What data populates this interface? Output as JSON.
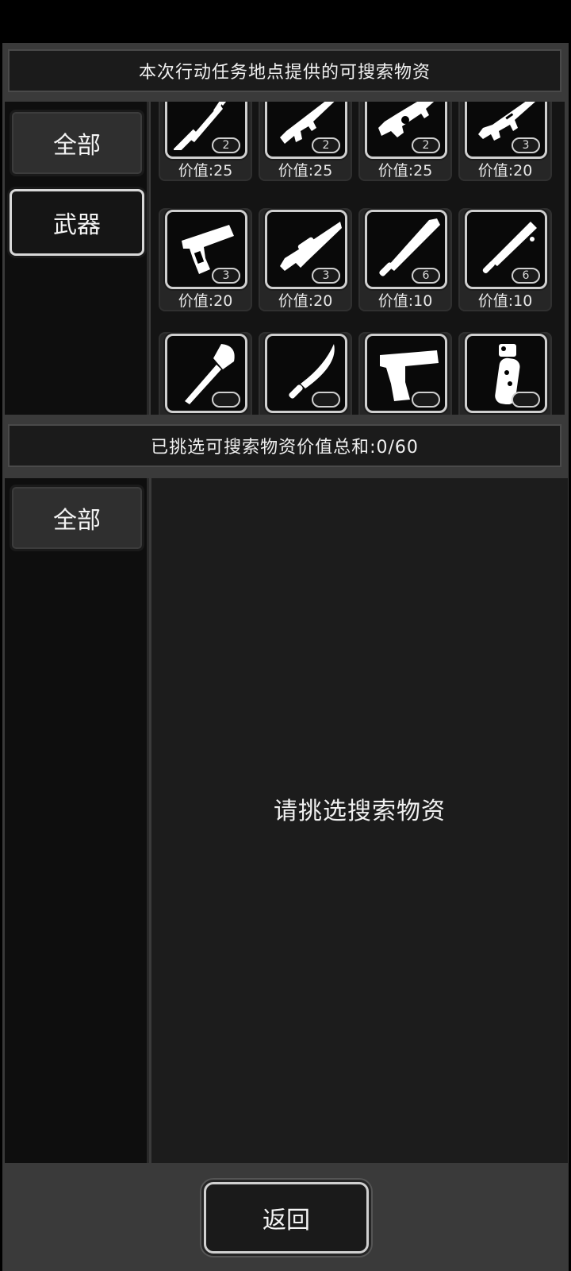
{
  "available": {
    "title": "本次行动任务地点提供的可搜索物资",
    "tabs": [
      {
        "label": "全部"
      },
      {
        "label": "武器"
      }
    ],
    "items": [
      {
        "icon": "spear-icon",
        "count": "2",
        "price": "价值:25"
      },
      {
        "icon": "assault-rifle-icon",
        "count": "2",
        "price": "价值:25"
      },
      {
        "icon": "bullpup-rifle-icon",
        "count": "2",
        "price": "价值:25"
      },
      {
        "icon": "m16-rifle-icon",
        "count": "3",
        "price": "价值:20"
      },
      {
        "icon": "pistol-icon",
        "count": "3",
        "price": "价值:20"
      },
      {
        "icon": "sniper-rifle-icon",
        "count": "3",
        "price": "价值:20"
      },
      {
        "icon": "machete-icon",
        "count": "6",
        "price": "价值:10"
      },
      {
        "icon": "spiked-club-icon",
        "count": "6",
        "price": "价值:10"
      },
      {
        "icon": "shovel-icon",
        "count": "",
        "price": ""
      },
      {
        "icon": "curved-knife-icon",
        "count": "",
        "price": ""
      },
      {
        "icon": "desert-eagle-icon",
        "count": "",
        "price": ""
      },
      {
        "icon": "grenade-icon",
        "count": "",
        "price": ""
      }
    ]
  },
  "selected": {
    "title": "已挑选可搜索物资价值总和:0/60",
    "tabs": [
      {
        "label": "全部"
      }
    ],
    "empty_message": "请挑选搜索物资"
  },
  "footer": {
    "back_label": "返回"
  }
}
